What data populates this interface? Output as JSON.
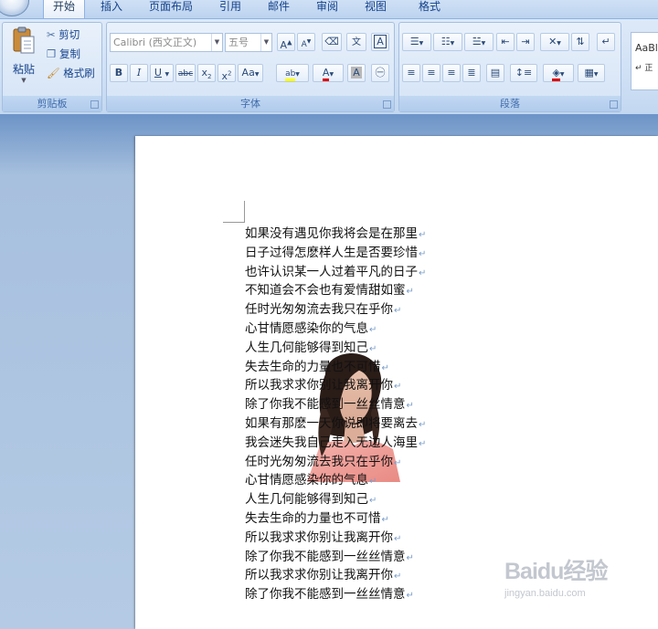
{
  "tabs": [
    "开始",
    "插入",
    "页面布局",
    "引用",
    "邮件",
    "审阅",
    "视图",
    "格式"
  ],
  "clipboard": {
    "paste": "粘贴",
    "cut": "剪切",
    "copy": "复制",
    "format_painter": "格式刷",
    "label": "剪贴板"
  },
  "font_group": {
    "font_name": "Calibri (西文正文)",
    "font_size": "五号",
    "label": "字体"
  },
  "paragraph_group": {
    "label": "段落"
  },
  "styles_group": {
    "preview": "AaBl"
  },
  "document": {
    "lines": [
      "如果没有遇见你我将会是在那里",
      "日子过得怎麽样人生是否要珍惜",
      "也许认识某一人过着平凡的日子",
      "不知道会不会也有爱情甜如蜜",
      "任时光匆匆流去我只在乎你",
      "心甘情愿感染你的气息",
      "人生几何能够得到知己",
      "失去生命的力量也不可惜",
      "所以我求求你别让我离开你",
      "除了你我不能感到一丝丝情意",
      "如果有那麽一天你说即将要离去",
      "我会迷失我自己走入无边人海里",
      "任时光匆匆流去我只在乎你",
      "心甘情愿感染你的气息",
      "人生几何能够得到知己",
      "失去生命的力量也不可惜",
      "所以我求求你别让我离开你",
      "除了你我不能感到一丝丝情意",
      "所以我求求你别让我离开你",
      "除了你我不能感到一丝丝情意"
    ],
    "paragraph_mark": "↵"
  },
  "watermark": {
    "logo": "Baidu经验",
    "sub": "jingyan.baidu.com"
  },
  "colors": {
    "accent": "#15428b",
    "font_color": "#e00000",
    "highlight": "#ffff00"
  }
}
